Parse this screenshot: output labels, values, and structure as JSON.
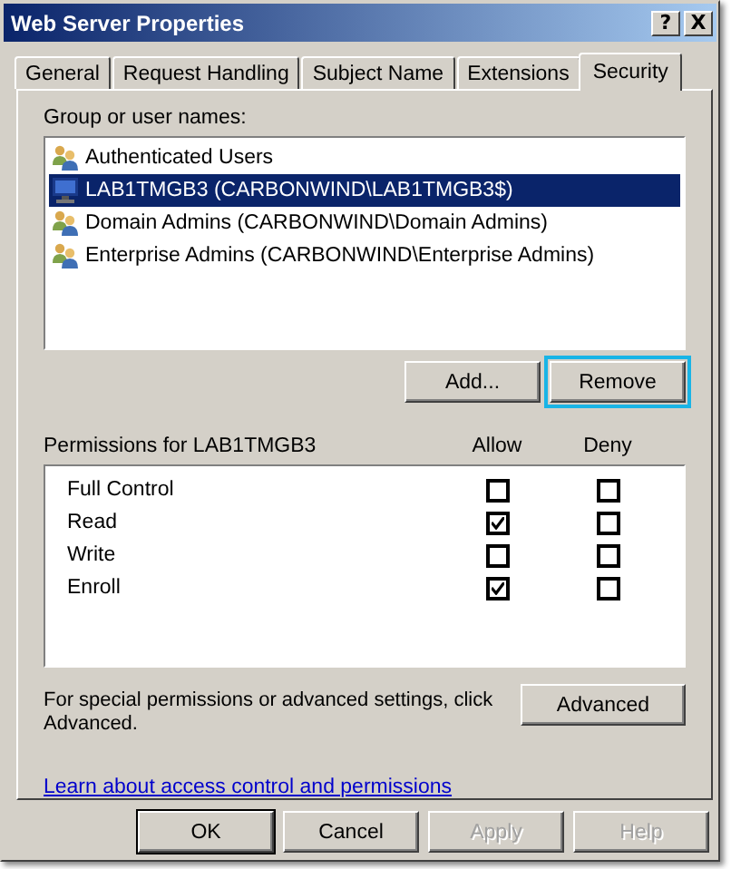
{
  "window": {
    "title": "Web Server Properties",
    "title_buttons": [
      "?",
      "X"
    ]
  },
  "tabs": [
    {
      "label": "General",
      "selected": false
    },
    {
      "label": "Request Handling",
      "selected": false
    },
    {
      "label": "Subject Name",
      "selected": false
    },
    {
      "label": "Extensions",
      "selected": false
    },
    {
      "label": "Security",
      "selected": true
    }
  ],
  "users": {
    "label": "Group or user names:",
    "items": [
      {
        "kind": "group",
        "name": "Authenticated Users",
        "selected": false
      },
      {
        "kind": "computer",
        "name": "LAB1TMGB3 (CARBONWIND\\LAB1TMGB3$)",
        "selected": true
      },
      {
        "kind": "group",
        "name": "Domain Admins (CARBONWIND\\Domain Admins)",
        "selected": false
      },
      {
        "kind": "group",
        "name": "Enterprise Admins (CARBONWIND\\Enterprise Admins)",
        "selected": false
      }
    ],
    "buttons": [
      {
        "label": "Add...",
        "focused": false
      },
      {
        "label": "Remove",
        "focused": true
      }
    ]
  },
  "permissions": {
    "label": "Permissions for LAB1TMGB3",
    "columns": [
      "Allow",
      "Deny"
    ],
    "rows": [
      {
        "name": "Full Control",
        "allow": false,
        "deny": false
      },
      {
        "name": "Read",
        "allow": true,
        "deny": false
      },
      {
        "name": "Write",
        "allow": false,
        "deny": false
      },
      {
        "name": "Enroll",
        "allow": true,
        "deny": false
      }
    ]
  },
  "advanced": {
    "text": "For special permissions or advanced settings, click Advanced.",
    "button": "Advanced"
  },
  "link": "Learn about access control and permissions",
  "footer_buttons": [
    {
      "label": "OK",
      "default": true,
      "disabled": false
    },
    {
      "label": "Cancel",
      "default": false,
      "disabled": false
    },
    {
      "label": "Apply",
      "default": false,
      "disabled": true
    },
    {
      "label": "Help",
      "default": false,
      "disabled": true
    }
  ]
}
